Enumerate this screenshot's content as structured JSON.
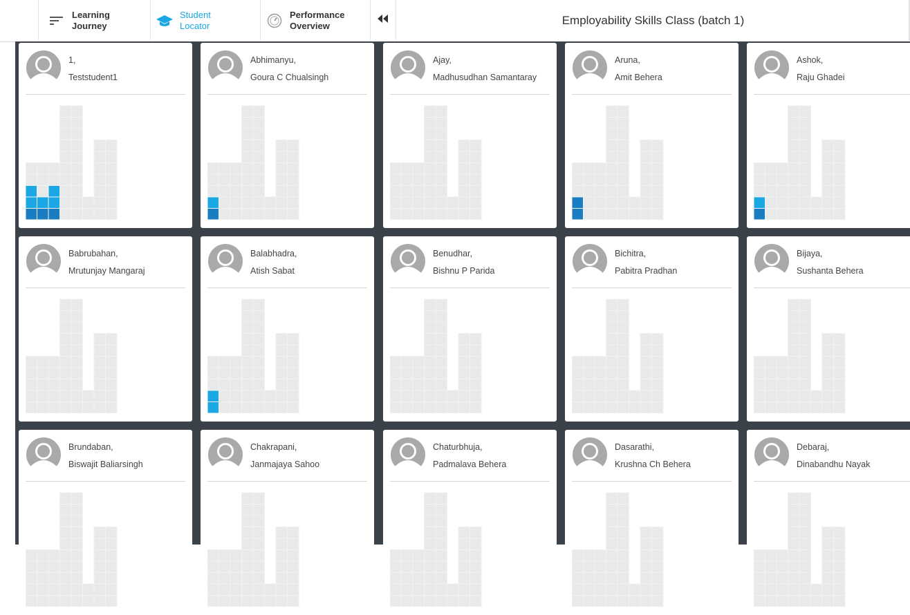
{
  "header": {
    "title": "Employability Skills Class (batch 1)",
    "nav": [
      {
        "label": "Learning\nJourney",
        "icon": "list-icon",
        "active": false
      },
      {
        "label": "Student\nLocator",
        "icon": "graduation-cap-icon",
        "active": true
      },
      {
        "label": "Performance\nOverview",
        "icon": "gauge-icon",
        "active": false
      }
    ],
    "collapse_icon": "double-chevron-left-icon",
    "accent_color": "#1aa7e3"
  },
  "colors": {
    "grid_background": "#3c4249",
    "cell_empty": "#e8e9ea",
    "cell_progress_light": "#1aa7e3",
    "cell_progress_dark": "#1a7dc2"
  },
  "students": [
    {
      "first": "1,",
      "last": "Teststudent1",
      "progress": [
        [
          2,
          2
        ],
        [
          2,
          1
        ],
        [
          2,
          2
        ],
        [
          0,
          0
        ],
        [
          0,
          0
        ],
        [
          0,
          0
        ],
        [
          0,
          0
        ],
        [
          0,
          0
        ]
      ]
    },
    {
      "first": "Abhimanyu,",
      "last": "Goura C Chualsingh",
      "progress": [
        [
          1,
          1
        ],
        [
          0,
          0
        ],
        [
          0,
          0
        ],
        [
          0,
          0
        ],
        [
          0,
          0
        ],
        [
          0,
          0
        ],
        [
          0,
          0
        ],
        [
          0,
          0
        ]
      ]
    },
    {
      "first": "Ajay,",
      "last": "Madhusudhan Samantaray",
      "progress": [
        [
          0,
          0
        ],
        [
          0,
          0
        ],
        [
          0,
          0
        ],
        [
          0,
          0
        ],
        [
          0,
          0
        ],
        [
          0,
          0
        ],
        [
          0,
          0
        ],
        [
          0,
          0
        ]
      ]
    },
    {
      "first": "Aruna,",
      "last": "Amit Behera",
      "progress": [
        [
          2,
          0
        ],
        [
          0,
          0
        ],
        [
          0,
          0
        ],
        [
          0,
          0
        ],
        [
          0,
          0
        ],
        [
          0,
          0
        ],
        [
          0,
          0
        ],
        [
          0,
          0
        ]
      ]
    },
    {
      "first": "Ashok,",
      "last": "Raju Ghadei",
      "progress": [
        [
          1,
          1
        ],
        [
          0,
          0
        ],
        [
          0,
          0
        ],
        [
          0,
          0
        ],
        [
          0,
          0
        ],
        [
          0,
          0
        ],
        [
          0,
          0
        ],
        [
          0,
          0
        ]
      ]
    },
    {
      "first": "Babrubahan,",
      "last": "Mrutunjay Mangaraj",
      "progress": [
        [
          0,
          0
        ],
        [
          0,
          0
        ],
        [
          0,
          0
        ],
        [
          0,
          0
        ],
        [
          0,
          0
        ],
        [
          0,
          0
        ],
        [
          0,
          0
        ],
        [
          0,
          0
        ]
      ]
    },
    {
      "first": "Balabhadra,",
      "last": "Atish Sabat",
      "progress": [
        [
          0,
          2
        ],
        [
          0,
          0
        ],
        [
          0,
          0
        ],
        [
          0,
          0
        ],
        [
          0,
          0
        ],
        [
          0,
          0
        ],
        [
          0,
          0
        ],
        [
          0,
          0
        ]
      ]
    },
    {
      "first": "Benudhar,",
      "last": "Bishnu P Parida",
      "progress": [
        [
          0,
          0
        ],
        [
          0,
          0
        ],
        [
          0,
          0
        ],
        [
          0,
          0
        ],
        [
          0,
          0
        ],
        [
          0,
          0
        ],
        [
          0,
          0
        ],
        [
          0,
          0
        ]
      ]
    },
    {
      "first": "Bichitra,",
      "last": "Pabitra Pradhan",
      "progress": [
        [
          0,
          0
        ],
        [
          0,
          0
        ],
        [
          0,
          0
        ],
        [
          0,
          0
        ],
        [
          0,
          0
        ],
        [
          0,
          0
        ],
        [
          0,
          0
        ],
        [
          0,
          0
        ]
      ]
    },
    {
      "first": "Bijaya,",
      "last": "Sushanta Behera",
      "progress": [
        [
          0,
          0
        ],
        [
          0,
          0
        ],
        [
          0,
          0
        ],
        [
          0,
          0
        ],
        [
          0,
          0
        ],
        [
          0,
          0
        ],
        [
          0,
          0
        ],
        [
          0,
          0
        ]
      ]
    },
    {
      "first": "Brundaban,",
      "last": "Biswajit Baliarsingh",
      "progress": [
        [
          0,
          0
        ],
        [
          0,
          0
        ],
        [
          0,
          0
        ],
        [
          0,
          0
        ],
        [
          0,
          0
        ],
        [
          0,
          0
        ],
        [
          0,
          0
        ],
        [
          0,
          0
        ]
      ]
    },
    {
      "first": "Chakrapani,",
      "last": "Janmajaya Sahoo",
      "progress": [
        [
          0,
          0
        ],
        [
          0,
          0
        ],
        [
          0,
          0
        ],
        [
          0,
          0
        ],
        [
          0,
          0
        ],
        [
          0,
          0
        ],
        [
          0,
          0
        ],
        [
          0,
          0
        ]
      ]
    },
    {
      "first": "Chaturbhuja,",
      "last": "Padmalava Behera",
      "progress": [
        [
          0,
          0
        ],
        [
          0,
          0
        ],
        [
          0,
          0
        ],
        [
          0,
          0
        ],
        [
          0,
          0
        ],
        [
          0,
          0
        ],
        [
          0,
          0
        ],
        [
          0,
          0
        ]
      ]
    },
    {
      "first": "Dasarathi,",
      "last": "Krushna Ch Behera",
      "progress": [
        [
          0,
          0
        ],
        [
          0,
          0
        ],
        [
          0,
          0
        ],
        [
          0,
          0
        ],
        [
          0,
          0
        ],
        [
          0,
          0
        ],
        [
          0,
          0
        ],
        [
          0,
          0
        ]
      ]
    },
    {
      "first": "Debaraj,",
      "last": "Dinabandhu Nayak",
      "progress": [
        [
          0,
          0
        ],
        [
          0,
          0
        ],
        [
          0,
          0
        ],
        [
          0,
          0
        ],
        [
          0,
          0
        ],
        [
          0,
          0
        ],
        [
          0,
          0
        ],
        [
          0,
          0
        ]
      ]
    }
  ]
}
